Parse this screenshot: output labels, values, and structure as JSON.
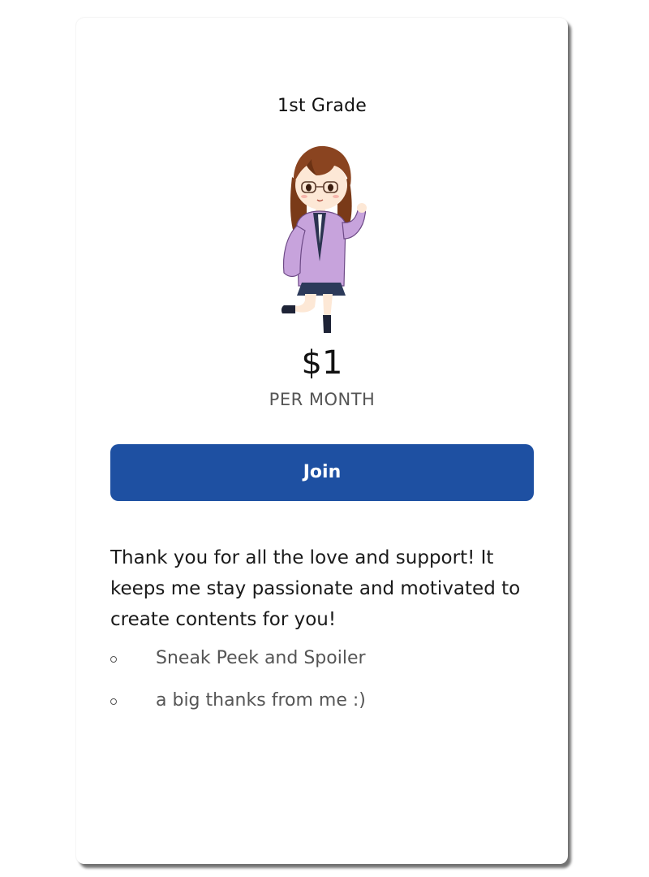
{
  "tier": {
    "title": "1st Grade",
    "price": "$1",
    "period": "PER MONTH",
    "join_label": "Join",
    "description": "Thank you for all the love and support! It keeps me stay passionate and motivated to create contents for you!",
    "perks": [
      "Sneak Peek and Spoiler",
      "a big thanks from me :)"
    ]
  },
  "colors": {
    "button": "#1e50a2",
    "button_text": "#ffffff",
    "background": "#ffffff"
  },
  "icons": {
    "avatar": "chibi-girl-illustration"
  }
}
